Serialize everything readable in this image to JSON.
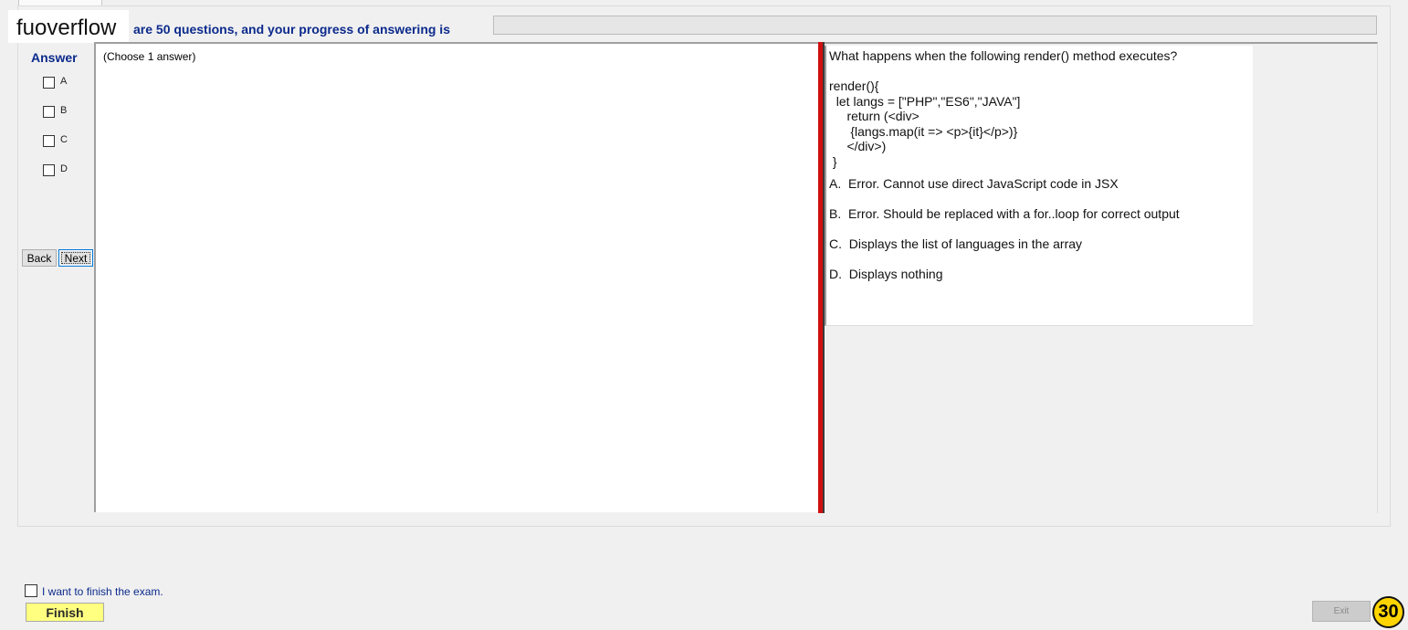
{
  "header": {
    "logo": "fuoverflow",
    "progress_text": "are 50 questions, and your progress of answering is",
    "progress_value": 0
  },
  "answer_panel": {
    "title": "Answer",
    "options": [
      "A",
      "B",
      "C",
      "D"
    ],
    "back_label": "Back",
    "next_label": "Next"
  },
  "content_panel": {
    "instruction": "(Choose 1 answer)"
  },
  "question": {
    "lines": [
      "What happens when the following render() method executes?",
      "",
      "render(){",
      "  let langs = [\"PHP\",\"ES6\",\"JAVA\"]",
      "     return (<div>",
      "      {langs.map(it => <p>{it}</p>)}",
      "     </div>)",
      " }"
    ],
    "choices": [
      "A.  Error. Cannot use direct JavaScript code in JSX",
      "B.  Error. Should be replaced with a for..loop for correct output",
      "C.  Displays the list of languages in the array",
      "D.  Displays nothing"
    ]
  },
  "footer": {
    "finish_checkbox_label": "I want to finish the exam.",
    "finish_label": "Finish",
    "exit_label": "Exit",
    "timer_value": "30"
  },
  "colors": {
    "accent": "#0b2a8c",
    "splitter": "#d01010",
    "finish_bg": "#ffff80",
    "timer_bg": "#ffd400"
  }
}
